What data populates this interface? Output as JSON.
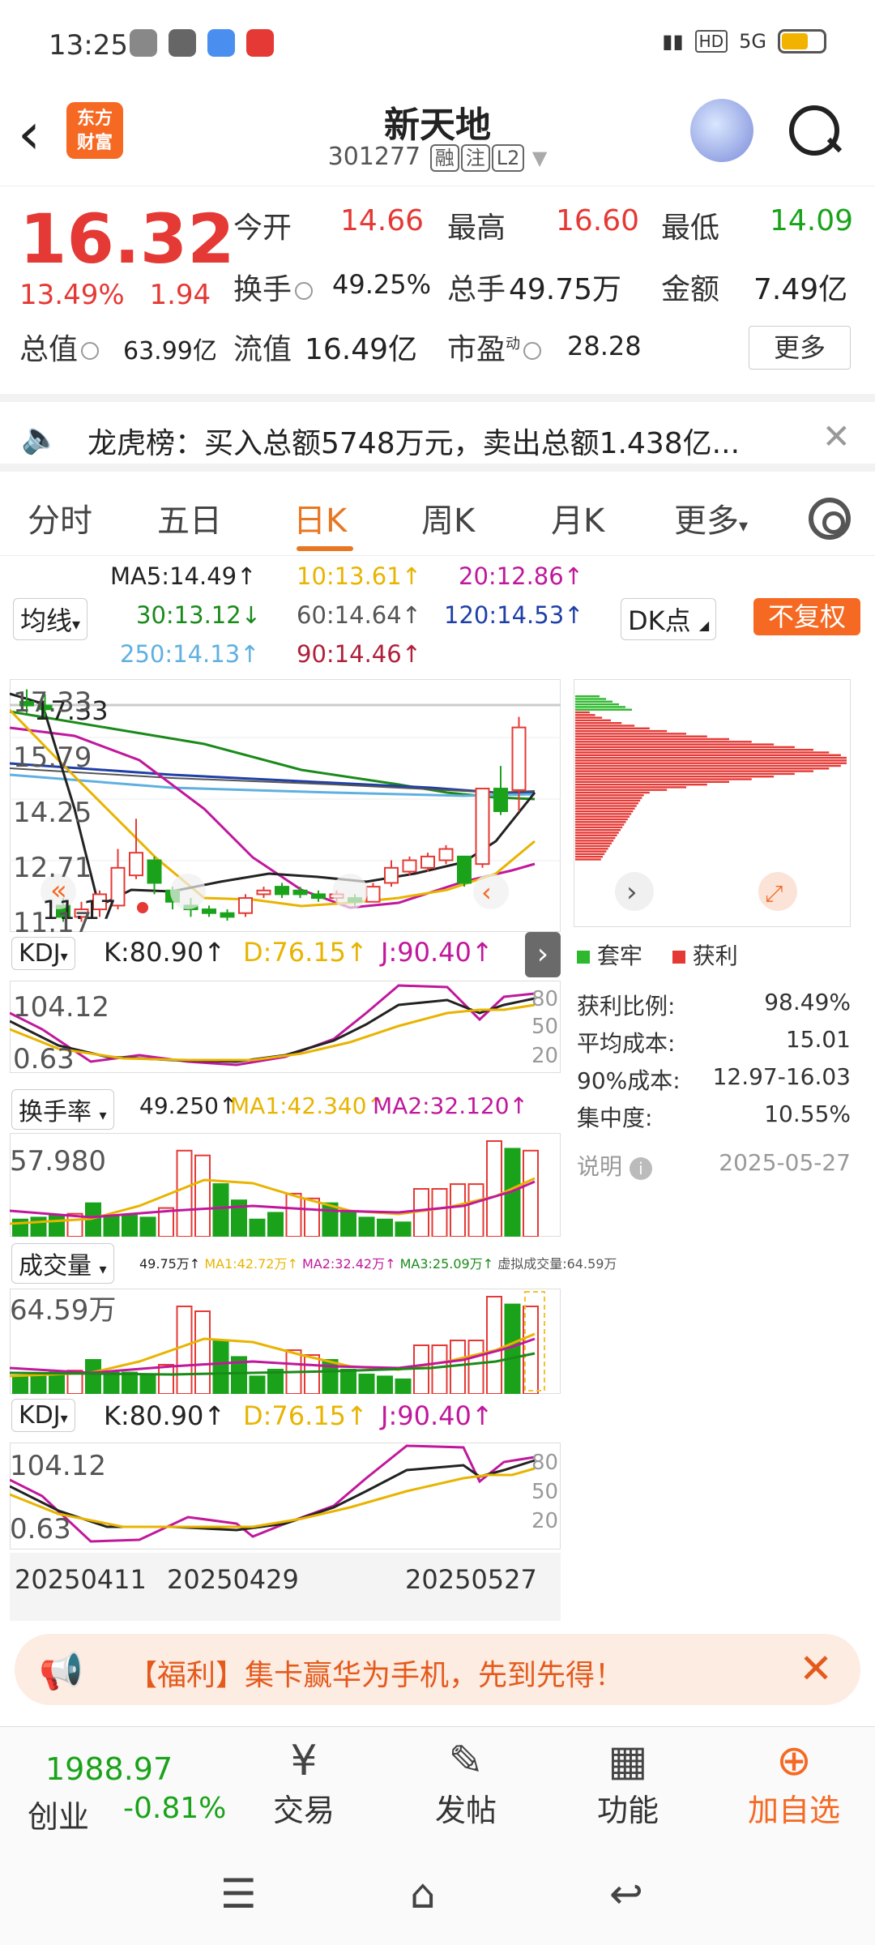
{
  "status": {
    "time": "13:25",
    "signal": "5G"
  },
  "header": {
    "back": "‹",
    "logo_line1": "东方",
    "logo_line2": "财富",
    "stock_name": "新天地",
    "stock_code": "301277",
    "tag_rong": "融",
    "tag_zhu": "注",
    "tag_l2": "L2"
  },
  "quote": {
    "price": "16.32",
    "change_pct": "13.49%",
    "change": "1.94",
    "open_label": "今开",
    "open": "14.66",
    "high_label": "最高",
    "high": "16.60",
    "low_label": "最低",
    "low": "14.09",
    "turnover_label": "换手",
    "turnover": "49.25%",
    "volume_label": "总手",
    "volume": "49.75万",
    "amount_label": "金额",
    "amount": "7.49亿",
    "mktcap_label": "总值",
    "mktcap": "63.99亿",
    "float_label": "流值",
    "float_cap": "16.49亿",
    "pe_label": "市盈",
    "pe_sup": "动",
    "pe": "28.28",
    "more": "更多"
  },
  "ticker": {
    "text": "龙虎榜：买入总额5748万元，卖出总额1.438亿...",
    "close": "✕"
  },
  "tabs": [
    {
      "label": "分时"
    },
    {
      "label": "五日"
    },
    {
      "label": "日K"
    },
    {
      "label": "周K"
    },
    {
      "label": "月K"
    },
    {
      "label": "更多"
    }
  ],
  "ma_legend": {
    "ma5": "MA5:14.49↑",
    "ma10": "10:13.61↑",
    "ma20": "20:12.86↑",
    "ma30": "30:13.12↓",
    "ma60": "60:14.64↑",
    "ma120": "120:14.53↑",
    "ma250": "250:14.13↑",
    "ma90": "90:14.46↑",
    "selector": "均线",
    "dk": "DK点",
    "fq": "不复权"
  },
  "kline": {
    "y_labels": [
      "17.33",
      "15.79",
      "14.25",
      "12.71",
      "11.17"
    ],
    "annotation_high": "17.33",
    "annotation_low": "11.17",
    "candles": [
      {
        "o": 17.0,
        "c": 16.9,
        "h": 17.33,
        "l": 16.7
      },
      {
        "o": 16.9,
        "c": 16.8,
        "h": 17.2,
        "l": 16.6
      },
      {
        "o": 11.6,
        "c": 11.3,
        "h": 11.8,
        "l": 11.17
      },
      {
        "o": 11.3,
        "c": 11.5,
        "h": 11.7,
        "l": 11.17
      },
      {
        "o": 11.5,
        "c": 11.9,
        "h": 12.0,
        "l": 11.3
      },
      {
        "o": 11.6,
        "c": 12.6,
        "h": 13.1,
        "l": 11.5
      },
      {
        "o": 12.4,
        "c": 13.0,
        "h": 13.9,
        "l": 12.3
      },
      {
        "o": 12.8,
        "c": 12.2,
        "h": 12.9,
        "l": 11.9
      },
      {
        "o": 12.0,
        "c": 11.7,
        "h": 12.1,
        "l": 11.5
      },
      {
        "o": 11.6,
        "c": 11.5,
        "h": 11.8,
        "l": 11.3
      },
      {
        "o": 11.5,
        "c": 11.4,
        "h": 11.6,
        "l": 11.3
      },
      {
        "o": 11.4,
        "c": 11.3,
        "h": 11.5,
        "l": 11.2
      },
      {
        "o": 11.4,
        "c": 11.8,
        "h": 11.9,
        "l": 11.3
      },
      {
        "o": 11.9,
        "c": 12.0,
        "h": 12.1,
        "l": 11.8
      },
      {
        "o": 12.1,
        "c": 11.9,
        "h": 12.2,
        "l": 11.8
      },
      {
        "o": 12.0,
        "c": 11.9,
        "h": 12.1,
        "l": 11.8
      },
      {
        "o": 11.9,
        "c": 11.8,
        "h": 12.0,
        "l": 11.7
      },
      {
        "o": 11.8,
        "c": 11.9,
        "h": 12.0,
        "l": 11.7
      },
      {
        "o": 11.8,
        "c": 11.7,
        "h": 11.9,
        "l": 11.6
      },
      {
        "o": 11.7,
        "c": 12.1,
        "h": 12.2,
        "l": 11.7
      },
      {
        "o": 12.2,
        "c": 12.6,
        "h": 12.8,
        "l": 12.1
      },
      {
        "o": 12.5,
        "c": 12.8,
        "h": 12.9,
        "l": 12.4
      },
      {
        "o": 12.6,
        "c": 12.9,
        "h": 13.0,
        "l": 12.5
      },
      {
        "o": 12.8,
        "c": 13.1,
        "h": 13.2,
        "l": 12.7
      },
      {
        "o": 12.9,
        "c": 12.2,
        "h": 12.9,
        "l": 12.1
      },
      {
        "o": 12.7,
        "c": 14.7,
        "h": 14.7,
        "l": 12.6
      },
      {
        "o": 14.7,
        "c": 14.1,
        "h": 15.3,
        "l": 14.0
      },
      {
        "o": 14.66,
        "c": 16.32,
        "h": 16.6,
        "l": 14.09
      }
    ]
  },
  "chip": {
    "legend_trapped": "套牢",
    "legend_profit": "获利",
    "stats": [
      {
        "label": "获利比例:",
        "value": "98.49%"
      },
      {
        "label": "平均成本:",
        "value": "15.01"
      },
      {
        "label": "90%成本:",
        "value": "12.97-16.03"
      },
      {
        "label": "集中度:",
        "value": "10.55%"
      }
    ],
    "note_label": "说明",
    "date": "2025-05-27"
  },
  "kdj1": {
    "selector": "KDJ",
    "k": "K:80.90↑",
    "d": "D:76.15↑",
    "j": "J:90.40↑",
    "y_top": "104.12",
    "y_bottom": "0.63",
    "levels": [
      "80",
      "50",
      "20"
    ]
  },
  "turnover_ind": {
    "selector": "换手率",
    "value": "49.250↑",
    "ma1": "MA1:42.340↑",
    "ma2": "MA2:32.120↑",
    "y_top": "57.980"
  },
  "volume_ind": {
    "selector": "成交量",
    "value": "49.75万↑",
    "ma1": "MA1:42.72万↑",
    "ma2": "MA2:32.42万↑",
    "ma3": "MA3:25.09万↑",
    "virtual": "虚拟成交量:64.59万",
    "y_top": "64.59万"
  },
  "kdj2": {
    "selector": "KDJ",
    "k": "K:80.90↑",
    "d": "D:76.15↑",
    "j": "J:90.40↑",
    "y_top": "104.12",
    "y_bottom": "0.63",
    "levels": [
      "80",
      "50",
      "20"
    ]
  },
  "dates": [
    "20250411",
    "20250429",
    "20250527"
  ],
  "bars": {
    "values": [
      0.18,
      0.2,
      0.22,
      0.24,
      0.35,
      0.22,
      0.22,
      0.2,
      0.3,
      0.9,
      0.85,
      0.55,
      0.38,
      0.18,
      0.25,
      0.45,
      0.4,
      0.35,
      0.25,
      0.2,
      0.18,
      0.15,
      0.5,
      0.5,
      0.55,
      0.55,
      1.0,
      0.92,
      0.9
    ],
    "up": [
      false,
      false,
      false,
      true,
      false,
      false,
      false,
      false,
      true,
      true,
      true,
      false,
      false,
      false,
      false,
      true,
      true,
      false,
      false,
      false,
      false,
      false,
      true,
      true,
      true,
      true,
      true,
      false,
      true
    ]
  },
  "banner": {
    "text": "【福利】集卡赢华为手机，先到先得！",
    "close": "✕"
  },
  "toolbar": {
    "index_value": "1988.97",
    "index_name": "创业",
    "index_change": "-0.81%",
    "trade": "交易",
    "post": "发帖",
    "func": "功能",
    "add": "加自选"
  },
  "colors": {
    "up": "#e53935",
    "down": "#1aa31a",
    "accent": "#f56923"
  }
}
